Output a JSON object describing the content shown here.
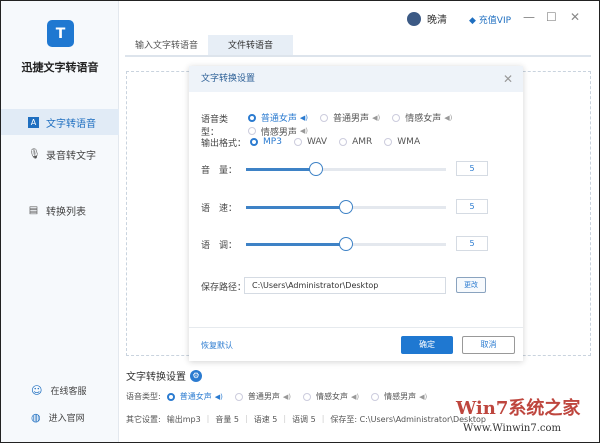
{
  "app": {
    "name": "迅捷文字转语音",
    "logo": "T"
  },
  "sidebar": {
    "items": [
      {
        "label": "文字转语音",
        "icon": "A"
      },
      {
        "label": "录音转文字",
        "icon": "🎙"
      },
      {
        "label": "转换列表",
        "icon": "▤"
      }
    ],
    "footer": [
      {
        "label": "在线客服",
        "icon": "☺"
      },
      {
        "label": "进入官网",
        "icon": "◍"
      }
    ]
  },
  "header": {
    "user": "晚清",
    "vip": "充值VIP",
    "vip_icon": "◆",
    "minimize": "—",
    "maximize": "☐",
    "close": "✕"
  },
  "tabs": [
    {
      "label": "输入文字转语音"
    },
    {
      "label": "文件转语音"
    }
  ],
  "dialog": {
    "title": "文字转换设置",
    "close": "✕",
    "voice_label": "语音类型：",
    "voices": [
      "普通女声",
      "普通男声",
      "情感女声",
      "情感男声"
    ],
    "voice_selected": 0,
    "format_label": "输出格式：",
    "formats": [
      "MP3",
      "WAV",
      "AMR",
      "WMA"
    ],
    "format_selected": 0,
    "sliders": [
      {
        "label": "音　量：",
        "value": "5",
        "fraction": 0.35
      },
      {
        "label": "语　速：",
        "value": "5",
        "fraction": 0.5
      },
      {
        "label": "语　调：",
        "value": "5",
        "fraction": 0.5
      }
    ],
    "path_label": "保存路径：",
    "path": "C:\\Users\\Administrator\\Desktop",
    "change": "更改",
    "reset": "恢复默认",
    "ok": "确定",
    "cancel": "取消"
  },
  "bottom": {
    "title": "文字转换设置",
    "voice_label": "语音类型:",
    "voices": [
      "普通女声",
      "普通男声",
      "情感女声",
      "情感男声"
    ],
    "other_label": "其它设置:",
    "other": [
      "输出mp3",
      "音量 5",
      "语速 5",
      "语调 5",
      "保存至: C:\\Users\\Administrator\\Desktop"
    ]
  },
  "watermark": {
    "brand": "Win7系统之家",
    "url": "Www.Winwin7.com"
  }
}
